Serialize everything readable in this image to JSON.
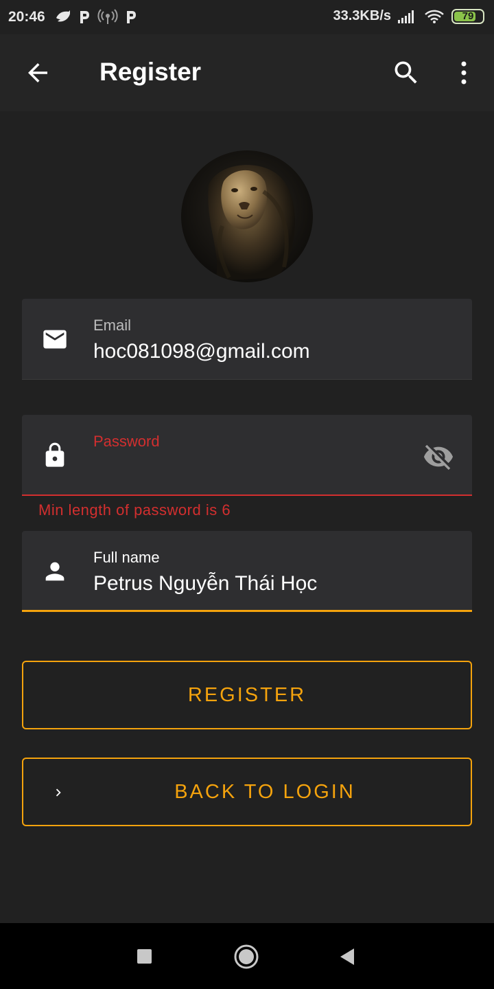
{
  "status_bar": {
    "time": "20:46",
    "left_icons": [
      "bird-icon",
      "p-icon",
      "hotspot-icon",
      "p-icon"
    ],
    "speed": "33.3KB/s",
    "battery_level": 79,
    "battery_text": "79"
  },
  "app_bar": {
    "title": "Register",
    "back_icon": "arrow-back-icon",
    "search_icon": "search-icon",
    "menu_icon": "more-vert-icon"
  },
  "avatar": {
    "icon": "lion-avatar"
  },
  "form": {
    "email": {
      "label": "Email",
      "value": "hoc081098@gmail.com",
      "icon": "mail-icon"
    },
    "password": {
      "label": "Password",
      "value": "",
      "icon": "lock-icon",
      "toggle_icon": "visibility-off-icon",
      "error": "Min length of password is 6"
    },
    "full_name": {
      "label": "Full name",
      "value": "Petrus Nguyễn Thái Học",
      "icon": "person-icon"
    }
  },
  "buttons": {
    "register": "REGISTER",
    "back_to_login": "BACK TO LOGIN"
  },
  "colors": {
    "accent": "#f5a30d",
    "error": "#d32f2f",
    "background": "#212121",
    "field_background": "#2e2e30"
  }
}
